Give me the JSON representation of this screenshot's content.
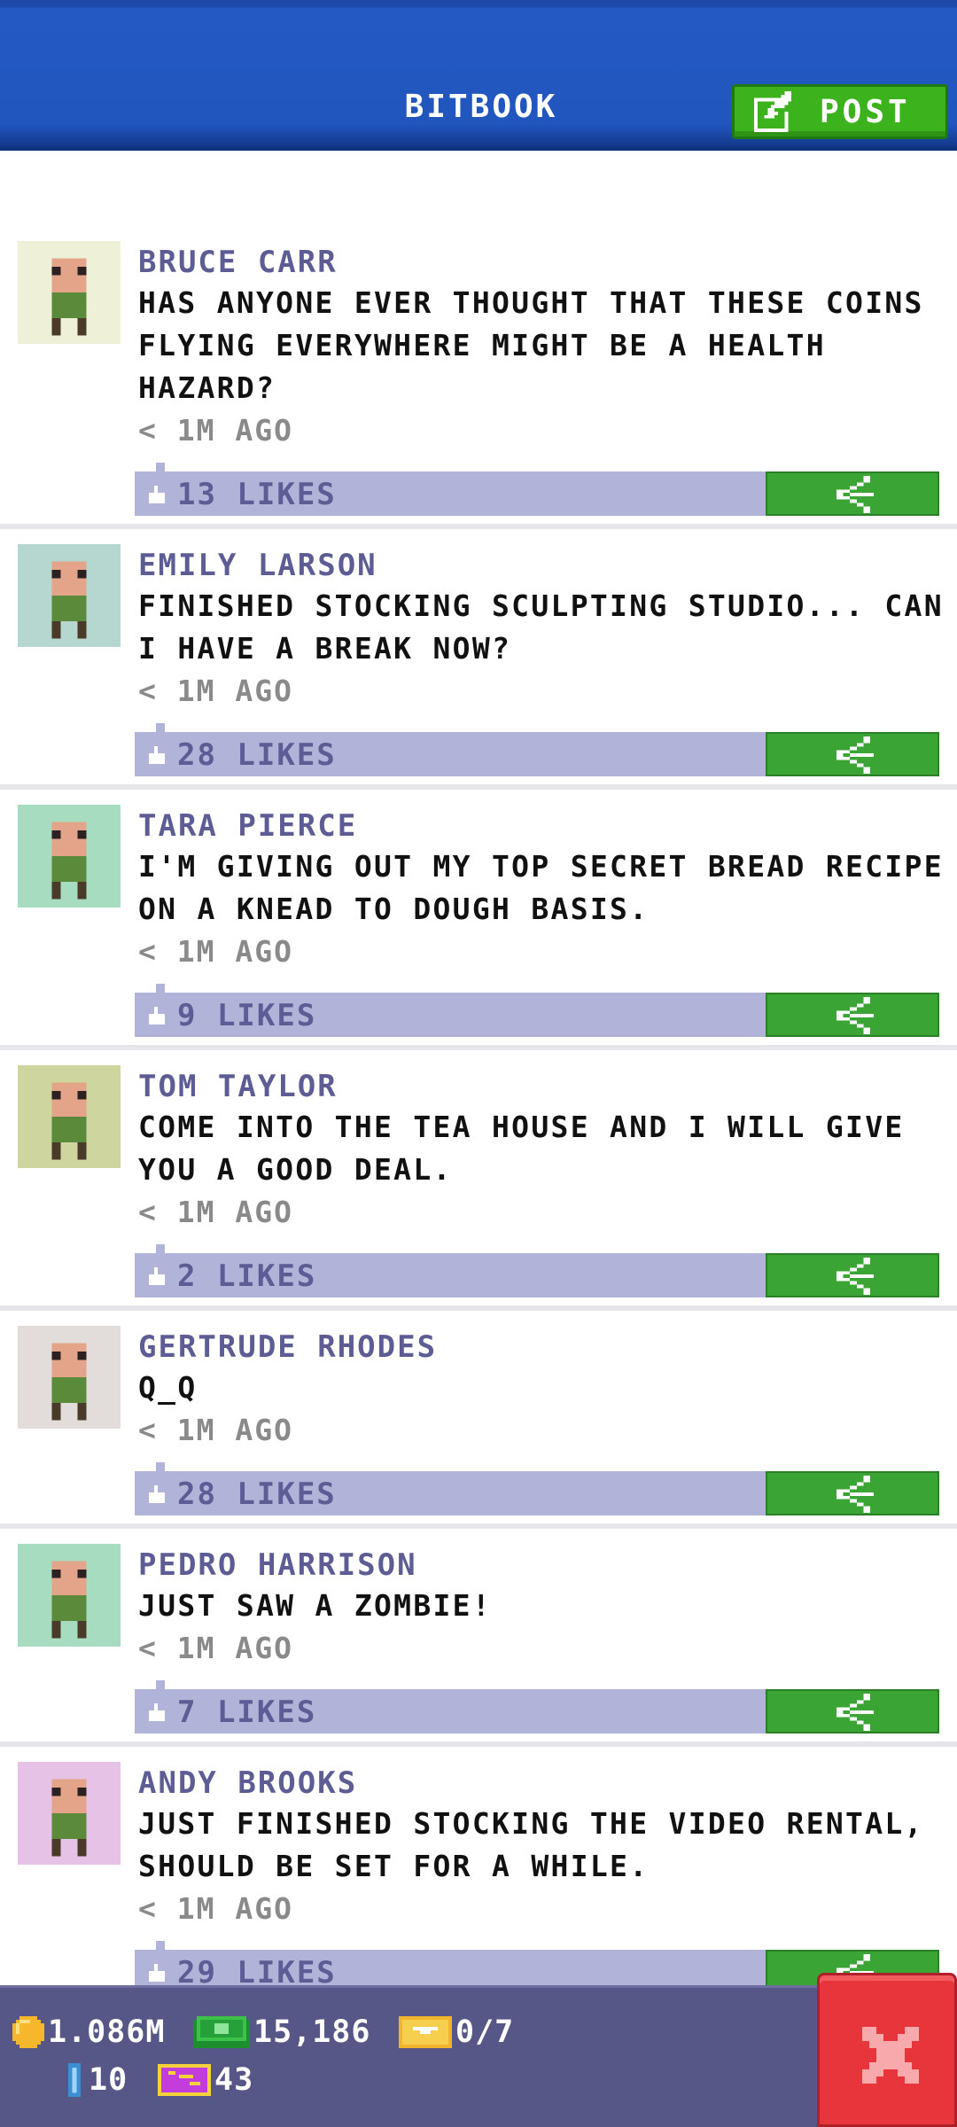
{
  "header": {
    "title": "BITBOOK",
    "post_label": "POST",
    "post_icon": "edit-icon"
  },
  "posts": [
    {
      "author": "BRUCE CARR",
      "text": "HAS ANYONE EVER THOUGHT THAT THESE COINS FLYING EVERYWHERE MIGHT BE A HEALTH HAZARD?",
      "time": "< 1M AGO",
      "likes": "13 LIKES",
      "avatar_bg": "#eef1d8"
    },
    {
      "author": "EMILY LARSON",
      "text": "FINISHED STOCKING SCULPTING STUDIO... CAN I HAVE A BREAK NOW?",
      "time": "< 1M AGO",
      "likes": "28 LIKES",
      "avatar_bg": "#b5d7cf"
    },
    {
      "author": "TARA PIERCE",
      "text": "I'M GIVING OUT MY TOP SECRET BREAD RECIPE ON A KNEAD TO DOUGH BASIS.",
      "time": "< 1M AGO",
      "likes": "9 LIKES",
      "avatar_bg": "#a7dcc0"
    },
    {
      "author": "TOM TAYLOR",
      "text": "COME INTO THE TEA HOUSE AND I WILL GIVE YOU A GOOD DEAL.",
      "time": "< 1M AGO",
      "likes": "2 LIKES",
      "avatar_bg": "#cfd59e"
    },
    {
      "author": "GERTRUDE RHODES",
      "text": "Q_Q",
      "time": "< 1M AGO",
      "likes": "28 LIKES",
      "avatar_bg": "#e2dcdb"
    },
    {
      "author": "PEDRO HARRISON",
      "text": "JUST SAW A ZOMBIE!",
      "time": "< 1M AGO",
      "likes": "7 LIKES",
      "avatar_bg": "#a7dcc0"
    },
    {
      "author": "ANDY BROOKS",
      "text": "JUST FINISHED STOCKING THE VIDEO RENTAL, SHOULD BE SET FOR A WHILE.",
      "time": "< 1M AGO",
      "likes": "29 LIKES",
      "avatar_bg": "#e5c2e6"
    }
  ],
  "footer": {
    "coins": "1.086M",
    "bux": "15,186",
    "tickets": "0/7",
    "keys": "10",
    "vip": "43",
    "close_icon": "close-icon"
  },
  "colors": {
    "header_blue": "#2156be",
    "post_green": "#3cb21d",
    "author_purple": "#5e5c94",
    "likes_bar": "#b1b3d9",
    "share_green": "#3aa534",
    "footer_bg": "#565786",
    "close_red": "#e8353c"
  }
}
